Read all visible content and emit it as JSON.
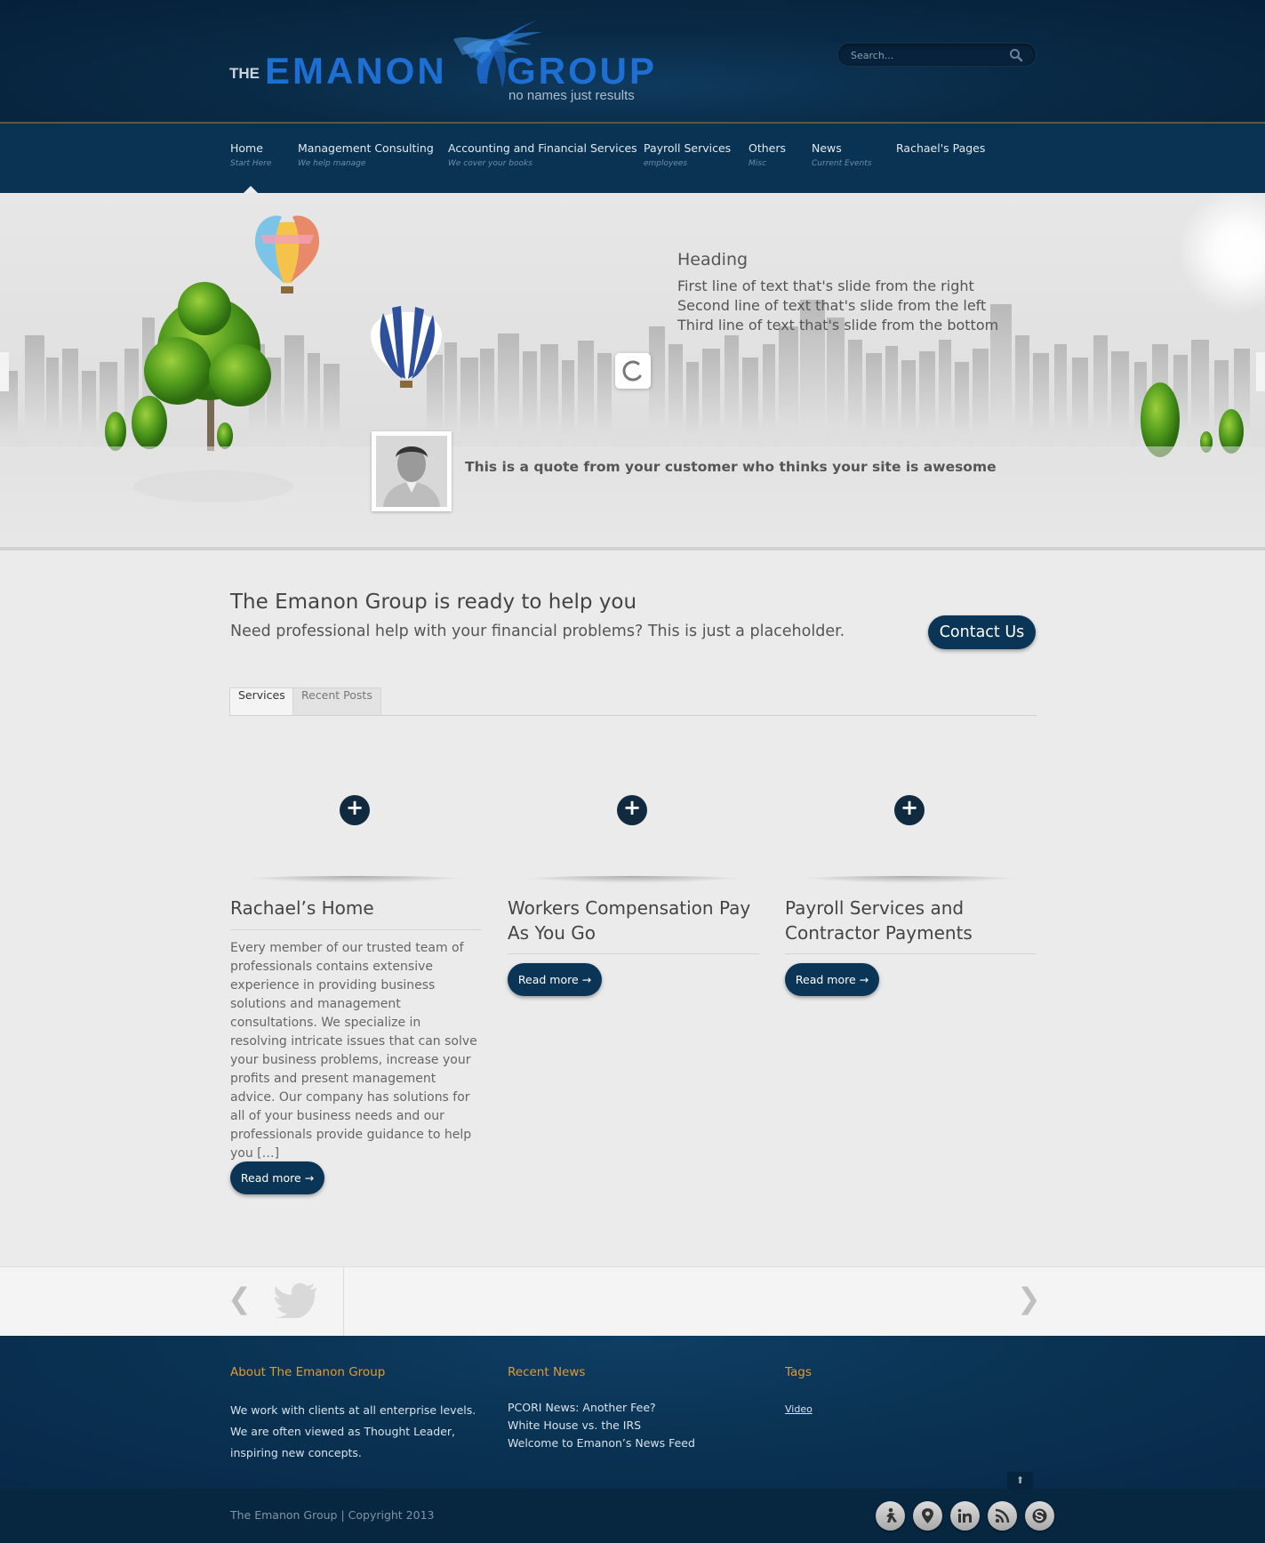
{
  "header": {
    "logo": {
      "the": "THE",
      "emanon": "EMANON",
      "group": "GROUP",
      "tagline": "no names just results"
    },
    "search": {
      "placeholder": "Search..."
    }
  },
  "nav": {
    "items": [
      {
        "label": "Home",
        "sub": "Start Here"
      },
      {
        "label": "Management Consulting",
        "sub": "We help manage"
      },
      {
        "label": "Accounting and Financial Services",
        "sub": "We cover your books"
      },
      {
        "label": "Payroll Services",
        "sub": "employees"
      },
      {
        "label": "Others",
        "sub": "Misc"
      },
      {
        "label": "News",
        "sub": "Current Events"
      },
      {
        "label": "Rachael's Pages",
        "sub": ""
      }
    ]
  },
  "slider": {
    "heading": "Heading",
    "lines": [
      "First line of text that's slide from the right",
      "Second line of text that's slide from the left",
      "Third line of text that's slide from the bottom"
    ],
    "quote": "This is a quote from your customer who thinks your site is awesome"
  },
  "cta": {
    "title": "The Emanon Group is ready to help you",
    "subtitle": "Need professional help with your financial problems? This is just a placeholder.",
    "button": "Contact Us"
  },
  "tabs": [
    {
      "label": "Services",
      "active": true
    },
    {
      "label": "Recent Posts",
      "active": false
    }
  ],
  "services": [
    {
      "title": "Rachael’s Home",
      "text": "Every member of our trusted team of professionals contains extensive experience in providing business solutions and management consultations. We specialize in resolving intricate issues that can solve your business problems, increase your profits and present management advice. Our company has solutions for all of your business needs and our professionals provide guidance to help you […]",
      "button": "Read more →"
    },
    {
      "title": "Workers Compensation Pay As You Go",
      "text": "",
      "button": "Read more →"
    },
    {
      "title": "Payroll Services and Contractor Payments",
      "text": "",
      "button": "Read more →"
    }
  ],
  "twitter": {
    "prev": "❮",
    "next": "❯"
  },
  "footer": {
    "about": {
      "heading": "About The Emanon Group",
      "text": "We work with clients at all enterprise levels. We are often viewed as Thought Leader, inspiring new concepts."
    },
    "news": {
      "heading": "Recent News",
      "items": [
        "PCORI News: Another Fee?",
        "White House vs. the IRS",
        "Welcome to Emanon’s News Feed"
      ]
    },
    "tags": {
      "heading": "Tags",
      "items": [
        "Video"
      ]
    },
    "to_top": "⬆",
    "copyright": "The Emanon Group | Copyright 2013",
    "social": [
      "aim-icon",
      "map-pin-icon",
      "linkedin-icon",
      "rss-icon",
      "skype-icon"
    ]
  },
  "colors": {
    "header_bg": "#06203a",
    "nav_bg": "#093253",
    "button_bg": "#0a3557",
    "footer_heading": "#e39a2d",
    "logo_blue": "#1e6fd4"
  }
}
